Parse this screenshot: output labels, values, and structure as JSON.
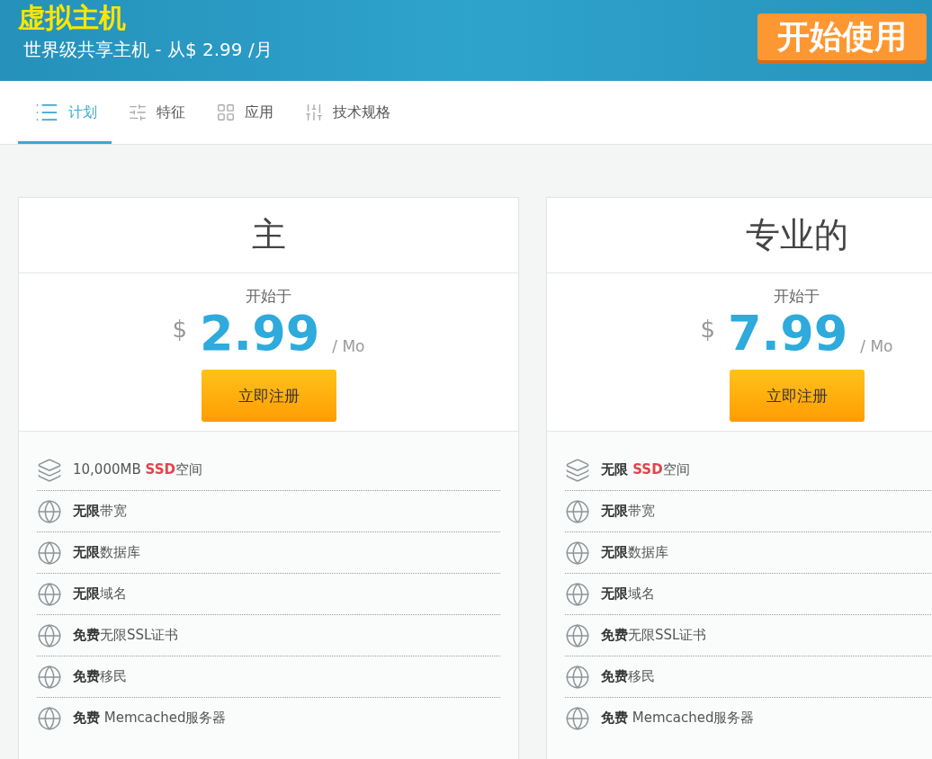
{
  "banner": {
    "title": "虚拟主机",
    "subtitle": "世界级共享主机 - 从$ 2.99 /月",
    "cta": "开始使用"
  },
  "tabs": [
    {
      "label": "计划",
      "kind": "list",
      "selected": true
    },
    {
      "label": "特征",
      "kind": "settings",
      "selected": false
    },
    {
      "label": "应用",
      "kind": "grid",
      "selected": false
    },
    {
      "label": "技术规格",
      "kind": "sliders",
      "selected": false
    }
  ],
  "plans": [
    {
      "name": "主",
      "starts_at": "开始于",
      "currency": "$",
      "price": "2.99",
      "period": "/ Mo",
      "button": "立即注册",
      "features": [
        {
          "kind": "storage",
          "parts": [
            {
              "kind": "plain",
              "text": "10,000MB "
            },
            {
              "kind": "highlight",
              "text": "SSD"
            },
            {
              "kind": "plain",
              "text": "空间"
            }
          ]
        },
        {
          "kind": "globe",
          "text": "**无限**带宽"
        },
        {
          "kind": "globe",
          "text": "**无限**数据库"
        },
        {
          "kind": "globe",
          "text": "**无限**域名"
        },
        {
          "kind": "globe",
          "text": "**免费**无限SSL证书"
        },
        {
          "kind": "globe",
          "text": "**免费**移民"
        },
        {
          "kind": "globe",
          "text": "**免费** Memcached服务器"
        }
      ]
    },
    {
      "name": "专业的",
      "starts_at": "开始于",
      "currency": "$",
      "price": "7.99",
      "period": "/ Mo",
      "button": "立即注册",
      "features": [
        {
          "kind": "storage",
          "parts": [
            {
              "kind": "bold",
              "text": "无限 "
            },
            {
              "kind": "highlight",
              "text": "SSD"
            },
            {
              "kind": "plain",
              "text": "空间"
            }
          ]
        },
        {
          "kind": "globe",
          "text": "**无限**带宽"
        },
        {
          "kind": "globe",
          "text": "**无限**数据库"
        },
        {
          "kind": "globe",
          "text": "**无限**域名"
        },
        {
          "kind": "globe",
          "text": "**免费**无限SSL证书"
        },
        {
          "kind": "globe",
          "text": "**免费**移民"
        },
        {
          "kind": "globe",
          "text": "**免费** Memcached服务器"
        }
      ]
    }
  ]
}
